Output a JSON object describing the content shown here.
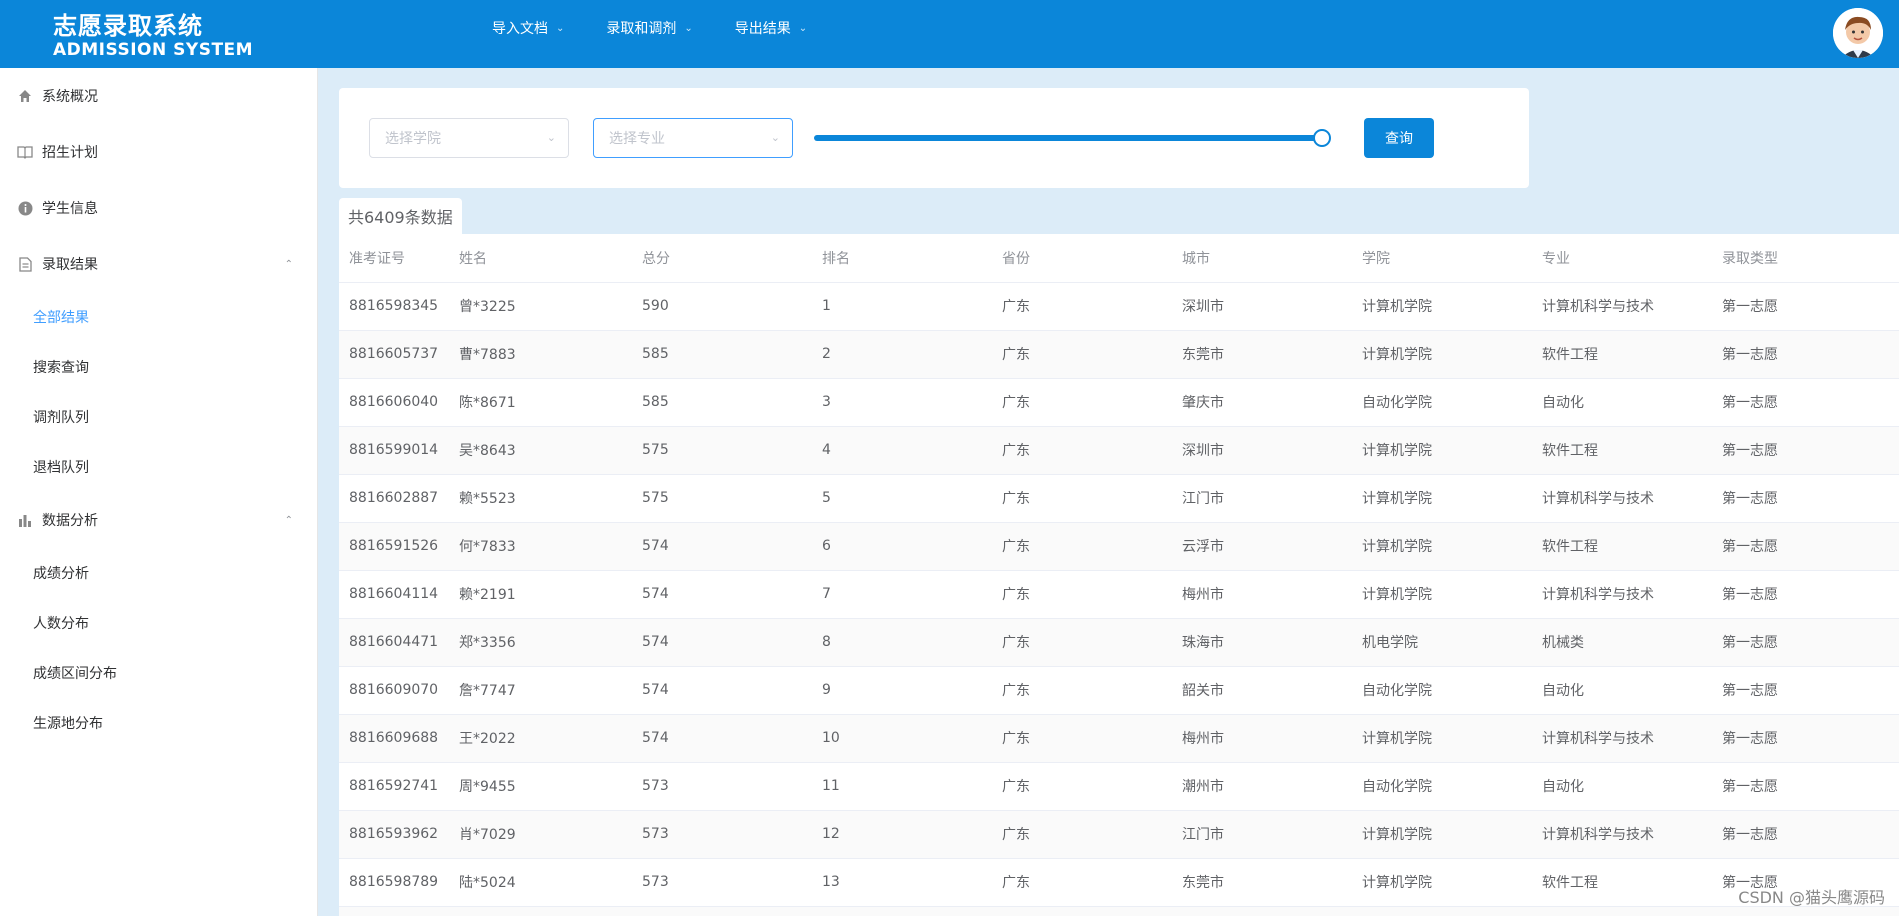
{
  "header": {
    "title_cn": "志愿录取系统",
    "title_en": "ADMISSION SYSTEM",
    "nav": [
      {
        "label": "导入文档"
      },
      {
        "label": "录取和调剂"
      },
      {
        "label": "导出结果"
      }
    ]
  },
  "sidebar": {
    "items": [
      {
        "label": "系统概况",
        "icon": "home-icon"
      },
      {
        "label": "招生计划",
        "icon": "book-icon"
      },
      {
        "label": "学生信息",
        "icon": "info-icon"
      },
      {
        "label": "录取结果",
        "icon": "document-icon"
      },
      {
        "label": "数据分析",
        "icon": "bar-chart-icon"
      }
    ],
    "admission_sub": [
      {
        "label": "全部结果"
      },
      {
        "label": "搜索查询"
      },
      {
        "label": "调剂队列"
      },
      {
        "label": "退档队列"
      }
    ],
    "analysis_sub": [
      {
        "label": "成绩分析"
      },
      {
        "label": "人数分布"
      },
      {
        "label": "成绩区间分布"
      },
      {
        "label": "生源地分布"
      }
    ]
  },
  "filter": {
    "college_placeholder": "选择学院",
    "major_placeholder": "选择专业",
    "slider_value_fraction": 1.0,
    "query_label": "查询"
  },
  "count_label": "共6409条数据",
  "table": {
    "columns": [
      "准考证号",
      "姓名",
      "总分",
      "排名",
      "省份",
      "城市",
      "学院",
      "专业",
      "录取类型"
    ],
    "rows": [
      [
        "8816598345",
        "曾*3225",
        "590",
        "1",
        "广东",
        "深圳市",
        "计算机学院",
        "计算机科学与技术",
        "第一志愿"
      ],
      [
        "8816605737",
        "曹*7883",
        "585",
        "2",
        "广东",
        "东莞市",
        "计算机学院",
        "软件工程",
        "第一志愿"
      ],
      [
        "8816606040",
        "陈*8671",
        "585",
        "3",
        "广东",
        "肇庆市",
        "自动化学院",
        "自动化",
        "第一志愿"
      ],
      [
        "8816599014",
        "吴*8643",
        "575",
        "4",
        "广东",
        "深圳市",
        "计算机学院",
        "软件工程",
        "第一志愿"
      ],
      [
        "8816602887",
        "赖*5523",
        "575",
        "5",
        "广东",
        "江门市",
        "计算机学院",
        "计算机科学与技术",
        "第一志愿"
      ],
      [
        "8816591526",
        "何*7833",
        "574",
        "6",
        "广东",
        "云浮市",
        "计算机学院",
        "软件工程",
        "第一志愿"
      ],
      [
        "8816604114",
        "赖*2191",
        "574",
        "7",
        "广东",
        "梅州市",
        "计算机学院",
        "计算机科学与技术",
        "第一志愿"
      ],
      [
        "8816604471",
        "郑*3356",
        "574",
        "8",
        "广东",
        "珠海市",
        "机电学院",
        "机械类",
        "第一志愿"
      ],
      [
        "8816609070",
        "詹*7747",
        "574",
        "9",
        "广东",
        "韶关市",
        "自动化学院",
        "自动化",
        "第一志愿"
      ],
      [
        "8816609688",
        "王*2022",
        "574",
        "10",
        "广东",
        "梅州市",
        "计算机学院",
        "计算机科学与技术",
        "第一志愿"
      ],
      [
        "8816592741",
        "周*9455",
        "573",
        "11",
        "广东",
        "潮州市",
        "自动化学院",
        "自动化",
        "第一志愿"
      ],
      [
        "8816593962",
        "肖*7029",
        "573",
        "12",
        "广东",
        "江门市",
        "计算机学院",
        "计算机科学与技术",
        "第一志愿"
      ],
      [
        "8816598789",
        "陆*5024",
        "573",
        "13",
        "广东",
        "东莞市",
        "计算机学院",
        "软件工程",
        "第一志愿"
      ],
      [
        "",
        "",
        "",
        "",
        "",
        "",
        "",
        "",
        ""
      ]
    ]
  },
  "watermark": "CSDN @猫头鹰源码",
  "colors": {
    "primary": "#0b86d9",
    "active_menu": "#409eff",
    "page_bg": "#dcecf8"
  }
}
